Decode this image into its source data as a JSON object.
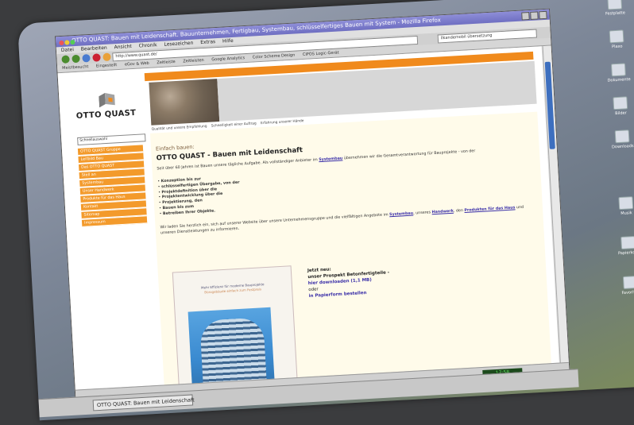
{
  "window": {
    "title": "OTTO QUAST: Bauen mit Leidenschaft. Bauunternehmen, Fertigbau, Systembau, schlüsselfertiges Bauen mit System - Mozilla Firefox",
    "menu": [
      "Datei",
      "Bearbeiten",
      "Ansicht",
      "Chronik",
      "Lesezeichen",
      "Extras",
      "Hilfe"
    ],
    "url": "http://www.quast.de/",
    "search": "ilkandemobil übersetzung",
    "bookmarks": [
      "Meistbesucht",
      "Eingestellt",
      "eGov & Web",
      "Zeitleiste",
      "Zeitleisten",
      "Google Analytics",
      "Color Scheme Design",
      "CIPOS Logic-Gerät"
    ]
  },
  "site": {
    "logo_text": "OTTO QUAST",
    "select_label": "Schnellauswahl",
    "nav": [
      "OTTO QUAST Gruppe",
      "Leitbild Bau",
      "Das OTTO QUAST",
      "Stell an",
      "Systembau",
      "Unser Handwerk",
      "Produkte für das Haus",
      "Kontakt",
      "Sitemap",
      "Impressum"
    ],
    "tabs": [
      "Qualität und unsere Empfehlung",
      "Schnelligkeit einer Auftrag",
      "Erfahrung unserer Hände"
    ],
    "small_heading": "Einfach bauen:",
    "title": "OTTO QUAST - Bauen mit Leidenschaft",
    "intro": "Seit über 60 Jahren ist Bauen unsere tägliche Aufgabe. Als vollständiger Anbieter im",
    "intro_link": "Systembau",
    "intro_tail": "übernehmen wir die Gesamtverantwortung für Bauprojekte - von der",
    "bullets": [
      "Konzeption bis zur",
      "schlüsselfertigen Übergabe, von der",
      "Projektdefinition über die",
      "Projektentwicklung über die",
      "Projektierung, den",
      "Bauen bis zum",
      "Betreiben Ihrer Objekte."
    ],
    "outro": "Wir laden Sie herzlich ein, sich auf unserer Website über unsere Unternehmensgruppe und die vielfältigen Angebote im",
    "outro_link1": "Systembau",
    "outro_and": ", unseres",
    "outro_link2": "Handwerk",
    "outro_mid": ", den",
    "outro_link3": "Produkten für das Haus",
    "outro_end": "und unseren Dienstleistungen zu informieren.",
    "brochure_title": "Mehr Effizienz für moderne Bauprojekte",
    "brochure_sub": "Bürogebäude einfach zum Festpreis",
    "promo_line1": "Jetzt neu:",
    "promo_line2": "unser Prospekt Betonfertigteile -",
    "promo_link1": "hier downloaden (1,1 MB)",
    "promo_or": "oder",
    "promo_link2": "in Papierform bestellen"
  },
  "taskbar": {
    "task_label": "OTTO QUAST: Bauen mit Leidenschaft",
    "clock": "17:58"
  },
  "desktop_icons": [
    "Festplatte",
    "Plaxo",
    "Dokumente",
    "Bilder",
    "Downloads",
    "Musik",
    "Papierkorb",
    "Favoriten"
  ],
  "colors": {
    "accent": "#f08a1c",
    "link": "#3a2fa8",
    "title_bar": "#6f6fc2"
  }
}
